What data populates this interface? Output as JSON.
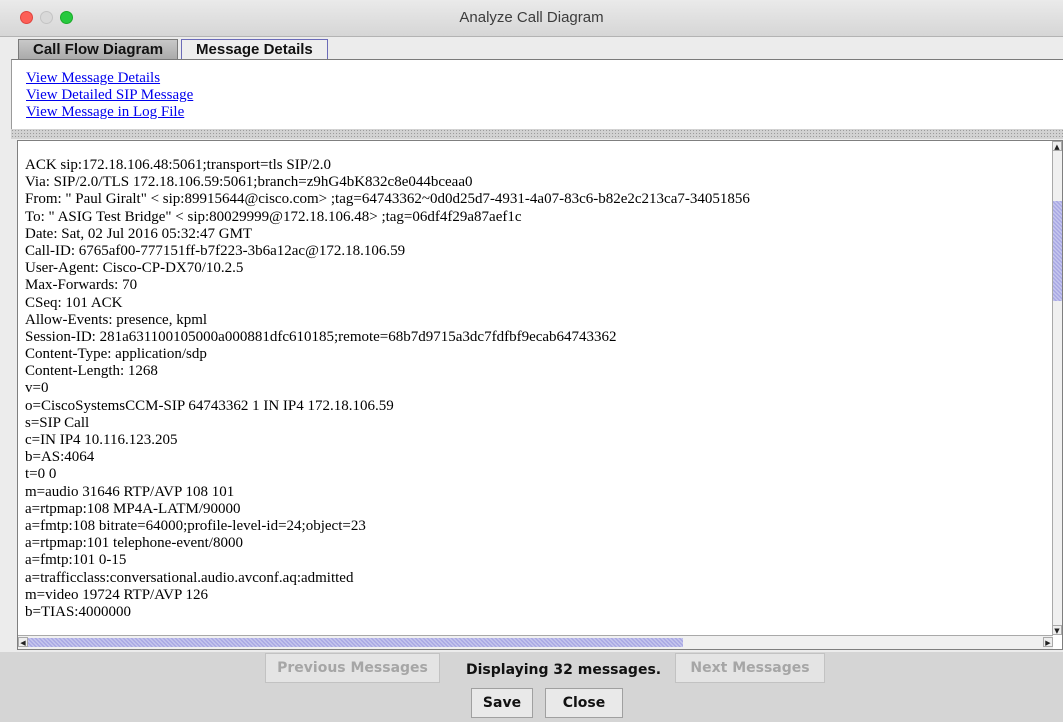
{
  "window": {
    "title": "Analyze Call Diagram"
  },
  "tabs": [
    {
      "label": "Call Flow Diagram"
    },
    {
      "label": "Message Details"
    }
  ],
  "links": [
    "View Message Details",
    "View Detailed SIP Message",
    "View Message in Log File"
  ],
  "message_lines": [
    "ACK sip:172.18.106.48:5061;transport=tls SIP/2.0",
    "Via: SIP/2.0/TLS 172.18.106.59:5061;branch=z9hG4bK832c8e044bceaa0",
    "From: \" Paul Giralt\" < sip:89915644@cisco.com> ;tag=64743362~0d0d25d7-4931-4a07-83c6-b82e2c213ca7-34051856",
    "To: \" ASIG Test Bridge\" < sip:80029999@172.18.106.48> ;tag=06df4f29a87aef1c",
    "Date: Sat, 02 Jul 2016 05:32:47 GMT",
    "Call-ID: 6765af00-777151ff-b7f223-3b6a12ac@172.18.106.59",
    "User-Agent: Cisco-CP-DX70/10.2.5",
    "Max-Forwards: 70",
    "CSeq: 101 ACK",
    "Allow-Events: presence, kpml",
    "Session-ID: 281a631100105000a000881dfc610185;remote=68b7d9715a3dc7fdfbf9ecab64743362",
    "Content-Type: application/sdp",
    "Content-Length: 1268",
    "v=0",
    "o=CiscoSystemsCCM-SIP 64743362 1 IN IP4 172.18.106.59",
    "s=SIP Call",
    "c=IN IP4 10.116.123.205",
    "b=AS:4064",
    "t=0 0",
    "m=audio 31646 RTP/AVP 108 101",
    "a=rtpmap:108 MP4A-LATM/90000",
    "a=fmtp:108 bitrate=64000;profile-level-id=24;object=23",
    "a=rtpmap:101 telephone-event/8000",
    "a=fmtp:101 0-15",
    "a=trafficclass:conversational.audio.avconf.aq:admitted",
    "m=video 19724 RTP/AVP 126",
    "b=TIAS:4000000"
  ],
  "footer": {
    "prev_label": "Previous Messages",
    "status": "Displaying 32 messages.",
    "next_label": "Next Messages",
    "save_label": "Save",
    "close_label": "Close"
  },
  "icons": {
    "scroll_up": "▲",
    "scroll_down": "▼",
    "scroll_left": "◀",
    "scroll_right": "▶"
  }
}
